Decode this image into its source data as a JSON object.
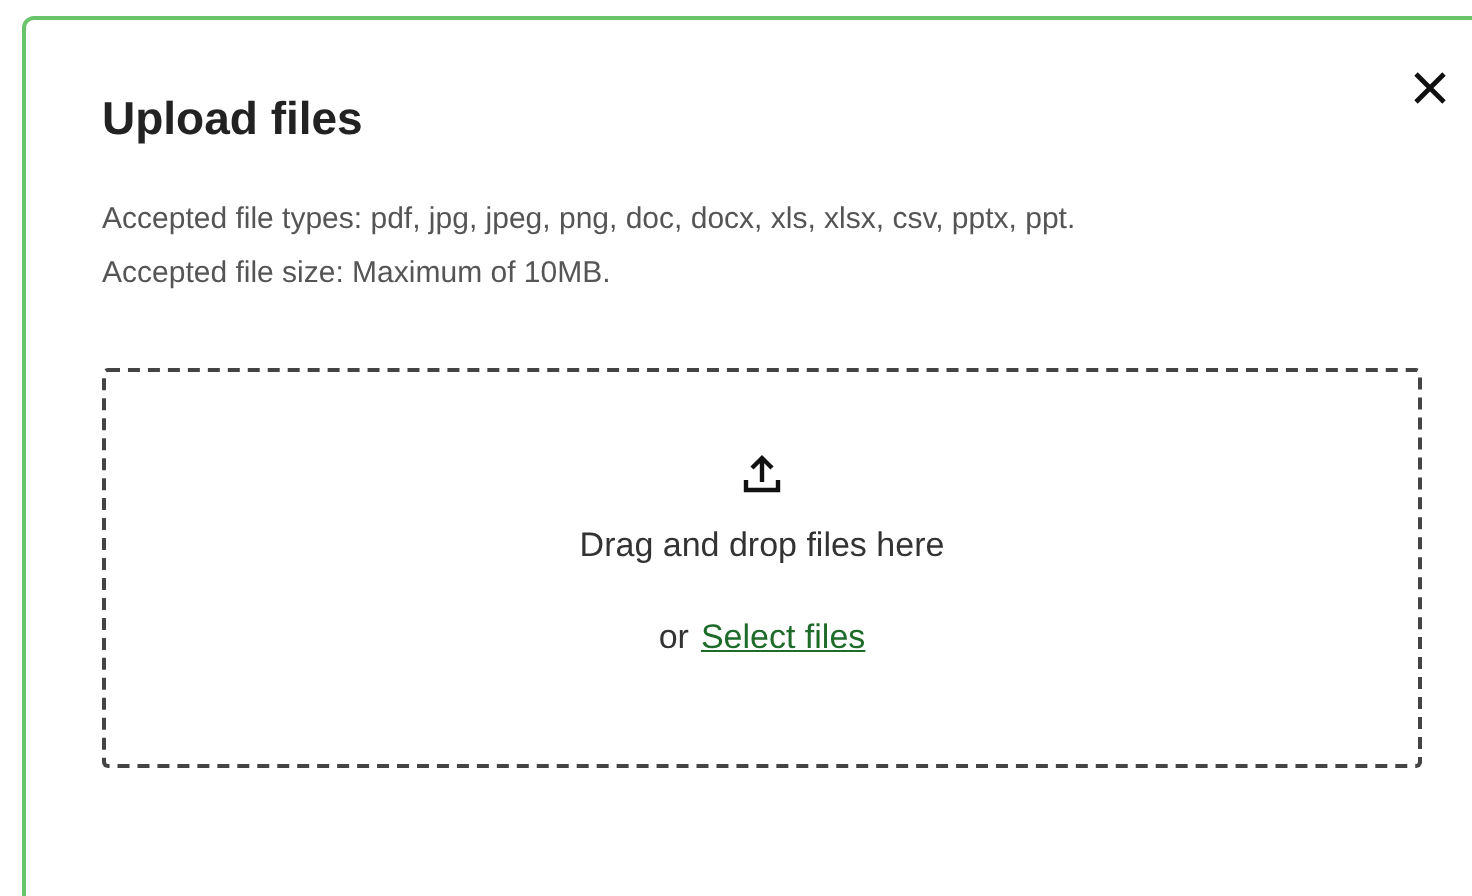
{
  "dialog": {
    "title": "Upload files",
    "accepted_types": "Accepted file types: pdf, jpg, jpeg, png, doc, docx, xls, xlsx, csv, pptx, ppt.",
    "accepted_size": "Accepted file size: Maximum of 10MB.",
    "dropzone": {
      "text": "Drag and drop files here",
      "prefix": "or",
      "link": "Select files"
    }
  }
}
